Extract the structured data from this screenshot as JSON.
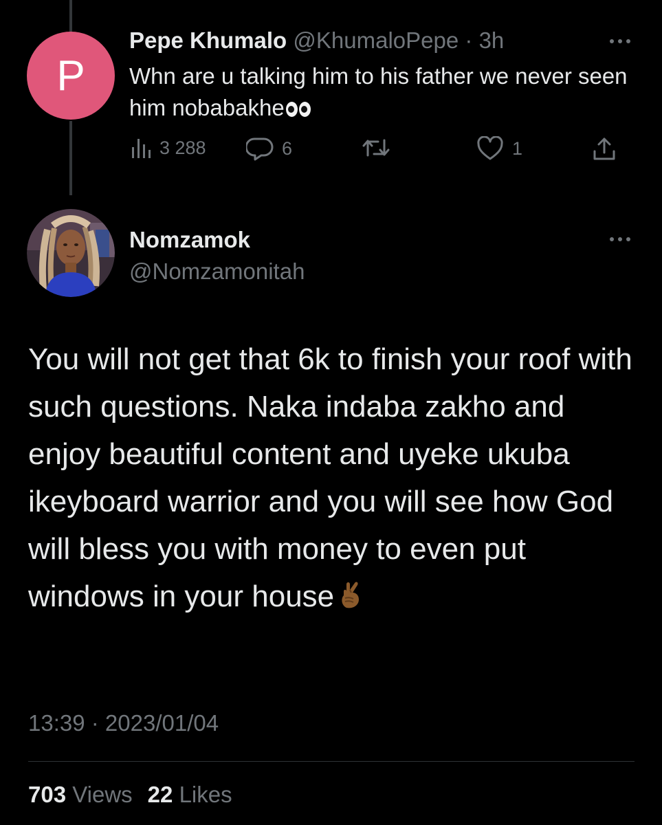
{
  "reply_tweet": {
    "avatar_letter": "P",
    "display_name": "Pepe Khumalo",
    "handle": "@KhumaloPepe",
    "separator": "·",
    "time": "3h",
    "text": "Whn are u talking him to his father we never seen him nobabakhe",
    "emoji": "eyes-emoji",
    "views_count": "3 288",
    "replies_count": "6",
    "retweets_count": "",
    "likes_count": "1"
  },
  "main_tweet": {
    "display_name": "Nomzamok",
    "handle": "@Nomzamonitah",
    "text": "You will not get that 6k to finish your roof with such questions. Naka indaba zakho and enjoy beautiful content and uyeke ukuba ikeyboard warrior and you will see how God will bless you with money to even put windows in your house",
    "emoji": "crossed-fingers-emoji",
    "timestamp": "13:39 · 2023/01/04",
    "views_count": "703",
    "views_label": "Views",
    "likes_count": "22",
    "likes_label": "Likes"
  },
  "colors": {
    "background": "#000000",
    "text_primary": "#e7e9ea",
    "text_secondary": "#71767b",
    "avatar_pink": "#e0577a",
    "divider": "#2f3336"
  },
  "icons": [
    "views-icon",
    "reply-icon",
    "retweet-icon",
    "like-icon",
    "share-icon",
    "more-icon"
  ]
}
